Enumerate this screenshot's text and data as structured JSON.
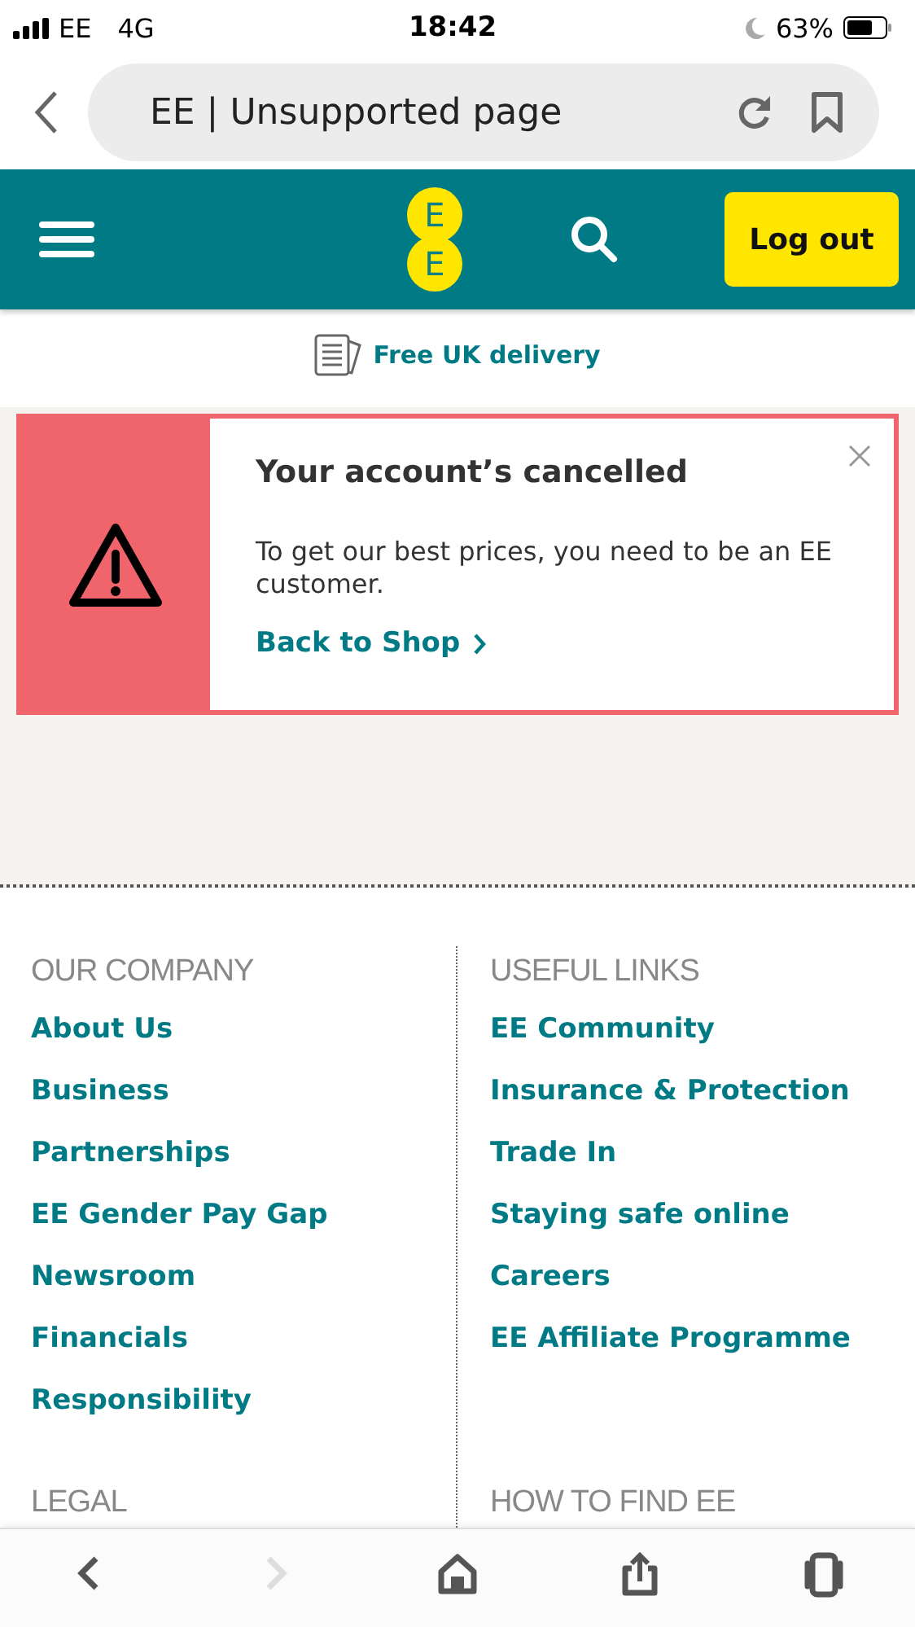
{
  "status_bar": {
    "carrier": "EE",
    "network": "4G",
    "time": "18:42",
    "battery": "63%"
  },
  "address_bar": {
    "title": "EE | Unsupported page"
  },
  "header": {
    "logo_letters": [
      "E",
      "E"
    ],
    "logout_button": "Log out"
  },
  "delivery_banner": {
    "text": "Free UK delivery"
  },
  "alert": {
    "title": "Your account’s cancelled",
    "message": "To get our best prices, you need to be an EE customer.",
    "link": "Back to Shop"
  },
  "footer": {
    "columns": [
      {
        "heading": "OUR COMPANY",
        "links": [
          "About Us",
          "Business",
          "Partnerships",
          "EE Gender Pay Gap",
          "Newsroom",
          "Financials",
          "Responsibility"
        ],
        "next_heading": "LEGAL"
      },
      {
        "heading": "USEFUL LINKS",
        "links": [
          "EE Community",
          "Insurance & Protection",
          "Trade In",
          "Staying safe online",
          "Careers",
          "EE Affiliate Programme"
        ],
        "next_heading": "HOW TO FIND EE"
      }
    ]
  },
  "toolbar": [
    {
      "kind": "back",
      "disabled": false
    },
    {
      "kind": "forward",
      "disabled": true
    },
    {
      "kind": "home",
      "disabled": false
    },
    {
      "kind": "share",
      "disabled": false
    },
    {
      "kind": "tabs",
      "disabled": false
    }
  ]
}
